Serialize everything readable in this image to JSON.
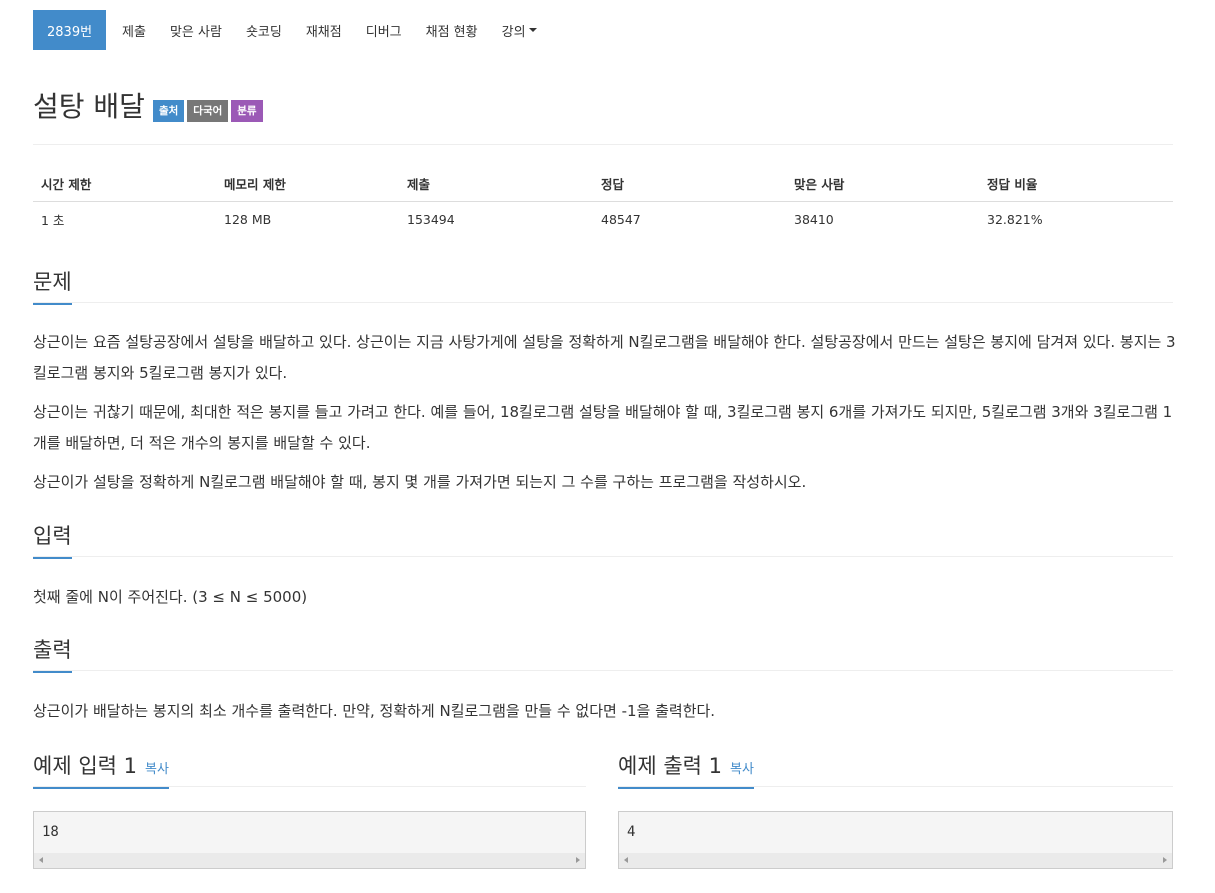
{
  "nav": {
    "items": [
      "2839번",
      "제출",
      "맞은 사람",
      "숏코딩",
      "재채점",
      "디버그",
      "채점 현황"
    ],
    "lecture": "강의"
  },
  "problem": {
    "title": "설탕 배달",
    "labels": [
      {
        "text": "출처",
        "color": "#428bca"
      },
      {
        "text": "다국어",
        "color": "#777777"
      },
      {
        "text": "분류",
        "color": "#9b59b6"
      }
    ]
  },
  "info": {
    "headers": [
      "시간 제한",
      "메모리 제한",
      "제출",
      "정답",
      "맞은 사람",
      "정답 비율"
    ],
    "values": [
      "1 초",
      "128 MB",
      "153494",
      "48547",
      "38410",
      "32.821%"
    ]
  },
  "sections": {
    "problem_heading": "문제",
    "problem_paragraphs": [
      "상근이는 요즘 설탕공장에서 설탕을 배달하고 있다. 상근이는 지금 사탕가게에 설탕을 정확하게 N킬로그램을 배달해야 한다. 설탕공장에서 만드는 설탕은 봉지에 담겨져 있다. 봉지는 3킬로그램 봉지와 5킬로그램 봉지가 있다.",
      "상근이는 귀찮기 때문에, 최대한 적은 봉지를 들고 가려고 한다. 예를 들어, 18킬로그램 설탕을 배달해야 할 때, 3킬로그램 봉지 6개를 가져가도 되지만, 5킬로그램 3개와 3킬로그램 1개를 배달하면, 더 적은 개수의 봉지를 배달할 수 있다.",
      "상근이가 설탕을 정확하게 N킬로그램 배달해야 할 때, 봉지 몇 개를 가져가면 되는지 그 수를 구하는 프로그램을 작성하시오."
    ],
    "input_heading": "입력",
    "input_text": "첫째 줄에 N이 주어진다. (3 ≤ N ≤ 5000)",
    "output_heading": "출력",
    "output_text": "상근이가 배달하는 봉지의 최소 개수를 출력한다. 만약, 정확하게 N킬로그램을 만들 수 없다면 -1을 출력한다."
  },
  "samples": {
    "input_heading": "예제 입력 1",
    "output_heading": "예제 출력 1",
    "copy_label": "복사",
    "input_value": "18",
    "output_value": "4"
  },
  "colors": {
    "primary": "#428bca",
    "text": "#333333",
    "border": "#eeeeee"
  }
}
